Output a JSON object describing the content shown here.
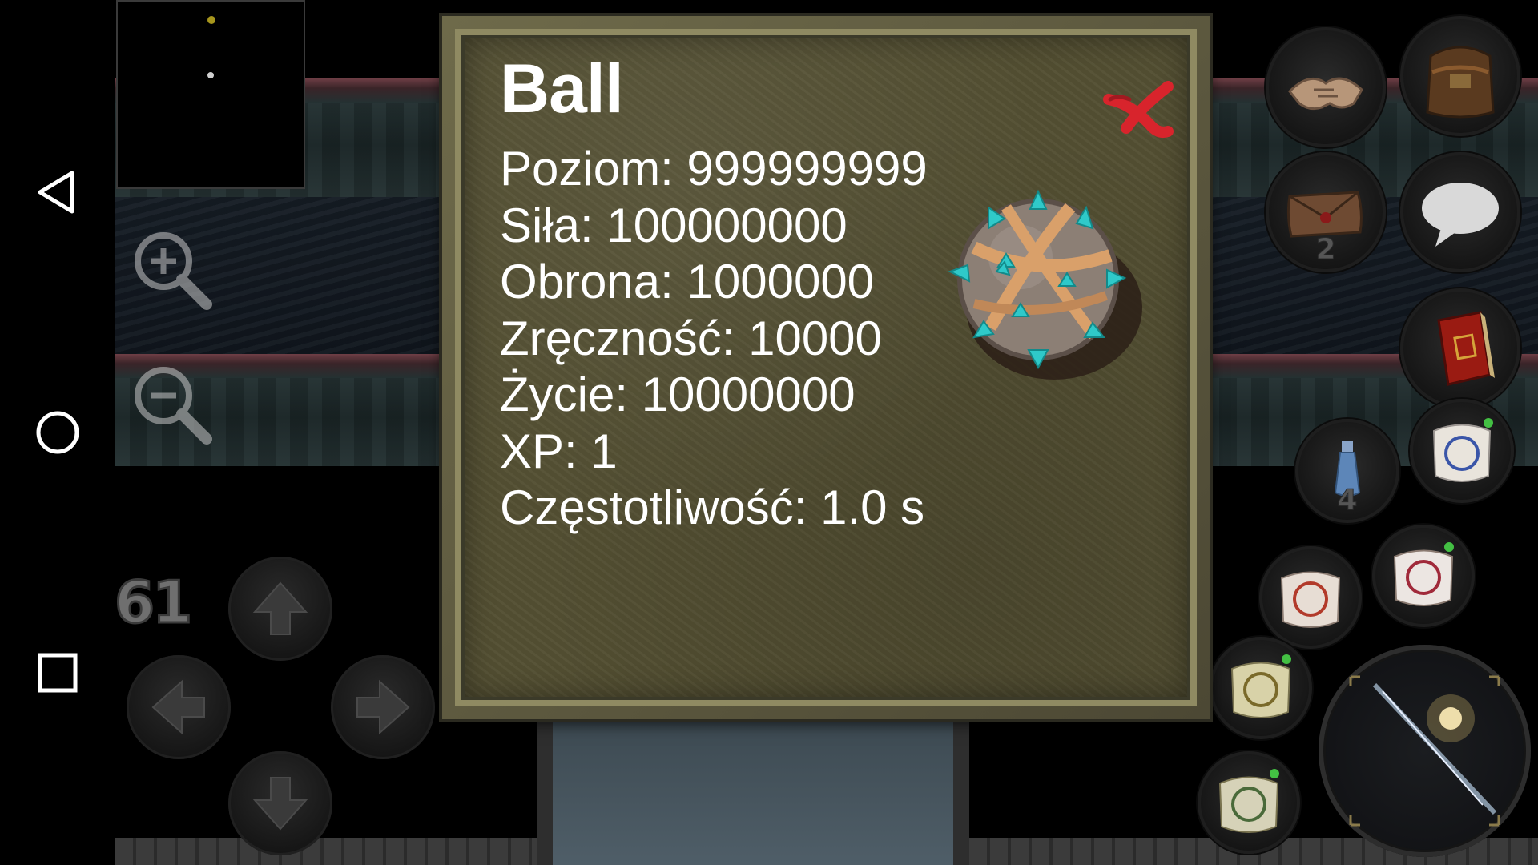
{
  "system_nav": {
    "back": "back-icon",
    "home": "home-icon",
    "recents": "recents-icon"
  },
  "hud": {
    "fps": "61",
    "zoom_in": "zoom-in-icon",
    "zoom_out": "zoom-out-icon",
    "letters_count": "2",
    "potion_count": "4",
    "buttons": [
      "trade-icon",
      "backpack-icon",
      "letters-icon",
      "chat-icon",
      "spellbook-icon",
      "potion-icon",
      "spell-scroll-icon"
    ]
  },
  "item_dialog": {
    "title": "Ball",
    "icon": "spiked-ball-icon",
    "close": "close-icon",
    "stats": [
      "Poziom: 999999999",
      "Siła: 100000000",
      "Obrona: 1000000",
      "Zręczność: 10000",
      "Życie: 10000000",
      "XP: 1",
      "Częstotliwość: 1.0 s"
    ]
  },
  "colors": {
    "dialog_bg": "#545033",
    "dialog_border": "#8f8a62",
    "close_red": "#d8242c",
    "spike_cyan": "#2fc9c9"
  }
}
